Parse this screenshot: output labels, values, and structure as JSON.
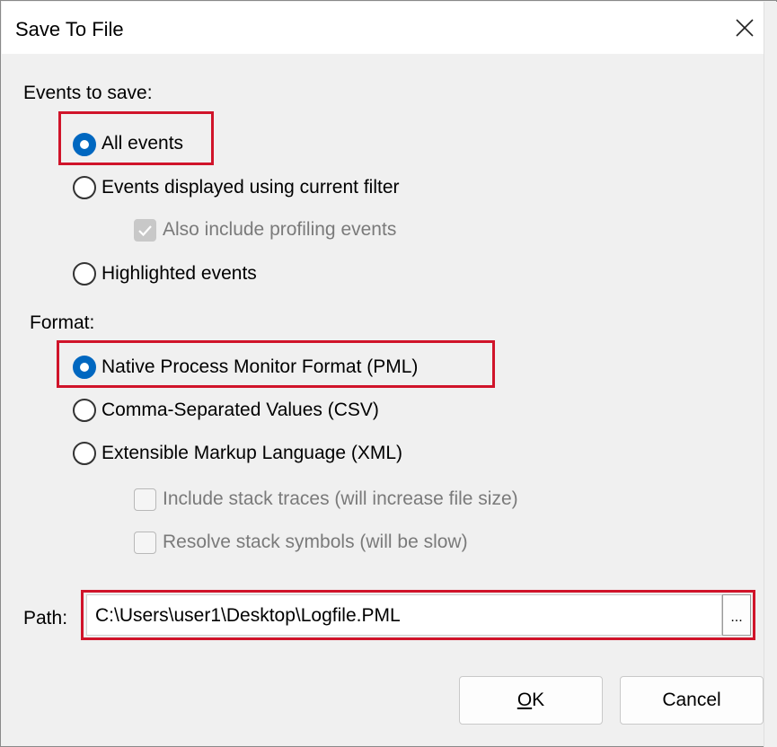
{
  "dialog": {
    "title": "Save To File",
    "close_glyph": "✕"
  },
  "events_section": {
    "label": "Events to save:",
    "options": [
      {
        "label": "All events",
        "selected": true
      },
      {
        "label": "Events displayed using current filter",
        "selected": false
      },
      {
        "label": "Highlighted events",
        "selected": false
      }
    ],
    "profiling_checkbox": {
      "label": "Also include profiling events",
      "checked": true,
      "enabled": false
    }
  },
  "format_section": {
    "label": "Format:",
    "options": [
      {
        "label": "Native Process Monitor Format (PML)",
        "selected": true
      },
      {
        "label": "Comma-Separated Values (CSV)",
        "selected": false
      },
      {
        "label": "Extensible Markup Language (XML)",
        "selected": false
      }
    ],
    "stack_traces_checkbox": {
      "label": "Include stack traces (will increase file size)",
      "checked": false,
      "enabled": false
    },
    "resolve_symbols_checkbox": {
      "label": "Resolve stack symbols (will be slow)",
      "checked": false,
      "enabled": false
    }
  },
  "path": {
    "label": "Path:",
    "value": "C:\\Users\\user1\\Desktop\\Logfile.PML",
    "browse_label": "..."
  },
  "buttons": {
    "ok_label_mnemonic": "O",
    "ok_label_rest": "K",
    "cancel_label": "Cancel"
  },
  "colors": {
    "highlight": "#d0142a",
    "radio_selected": "#0067c0"
  }
}
